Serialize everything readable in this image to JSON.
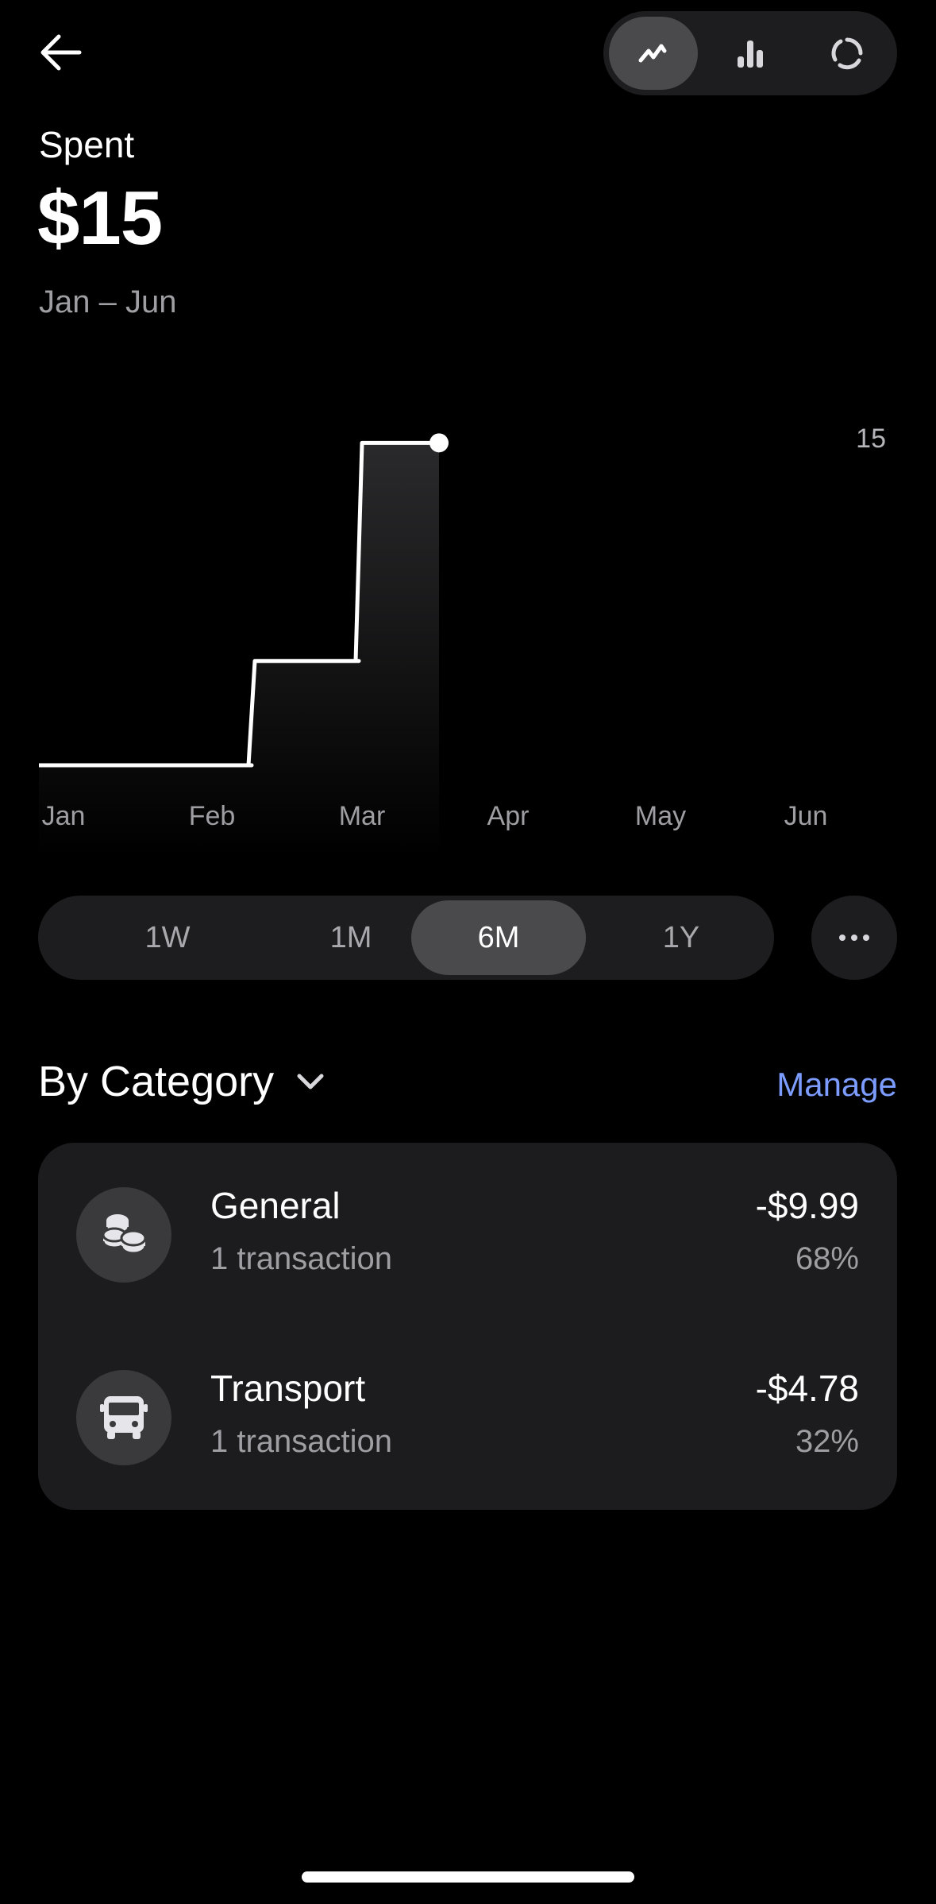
{
  "header": {
    "label": "Spent",
    "amount": "$15",
    "date_range": "Jan – Jun"
  },
  "icons": {
    "back": "arrow-left-icon",
    "view_line": "line-chart-icon",
    "view_bar": "bar-chart-icon",
    "view_ring": "ring-chart-icon",
    "more": "more-horizontal-icon",
    "dropdown": "chevron-down-icon",
    "general": "coins-icon",
    "transport": "bus-icon"
  },
  "view_toggle": {
    "selected": "line"
  },
  "chart_data": {
    "type": "line",
    "step": true,
    "categories": [
      "Jan",
      "Feb",
      "Mar",
      "Apr",
      "May",
      "Jun"
    ],
    "series": [
      {
        "values": [
          0,
          4.78,
          14.77
        ]
      }
    ],
    "y_axis_max_label": "15",
    "ylim": [
      0,
      15
    ],
    "grid": false,
    "colors": {
      "line": "#ffffff",
      "fill_top": "#2a2a2c",
      "fill_bottom": "#000000"
    }
  },
  "range": {
    "options": [
      "1W",
      "1M",
      "6M",
      "1Y"
    ],
    "selected": "6M"
  },
  "category_section": {
    "title": "By Category",
    "manage_label": "Manage",
    "items": [
      {
        "name": "General",
        "count": "1 transaction",
        "amount": "-$9.99",
        "percent": "68%"
      },
      {
        "name": "Transport",
        "count": "1 transaction",
        "amount": "-$4.78",
        "percent": "32%"
      }
    ]
  },
  "colors": {
    "accent": "#7c9dff",
    "background": "#000000",
    "card": "#1c1c1e",
    "pill": "#1d1d1f",
    "pill_active": "#4a4a4c"
  }
}
